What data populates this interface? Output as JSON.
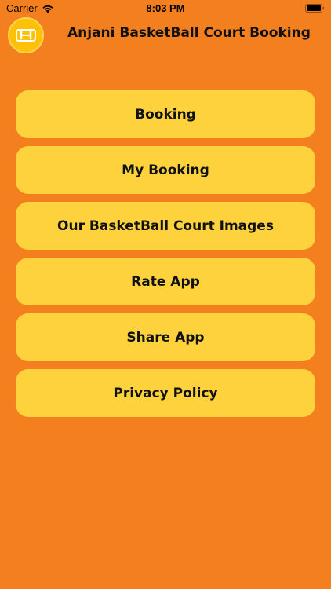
{
  "status_bar": {
    "carrier": "Carrier",
    "time": "8:03 PM",
    "wifi_icon": "wifi-icon",
    "battery_icon": "battery-icon"
  },
  "header": {
    "logo_icon": "dumbbell-icon",
    "title": "Anjani BasketBall Court Booking"
  },
  "colors": {
    "background": "#F47F1E",
    "button": "#FED23C",
    "logo": "#FFC107"
  },
  "menu": {
    "items": [
      {
        "label": "Booking"
      },
      {
        "label": "My Booking"
      },
      {
        "label": "Our BasketBall Court Images"
      },
      {
        "label": "Rate App"
      },
      {
        "label": "Share App"
      },
      {
        "label": "Privacy Policy"
      }
    ]
  }
}
